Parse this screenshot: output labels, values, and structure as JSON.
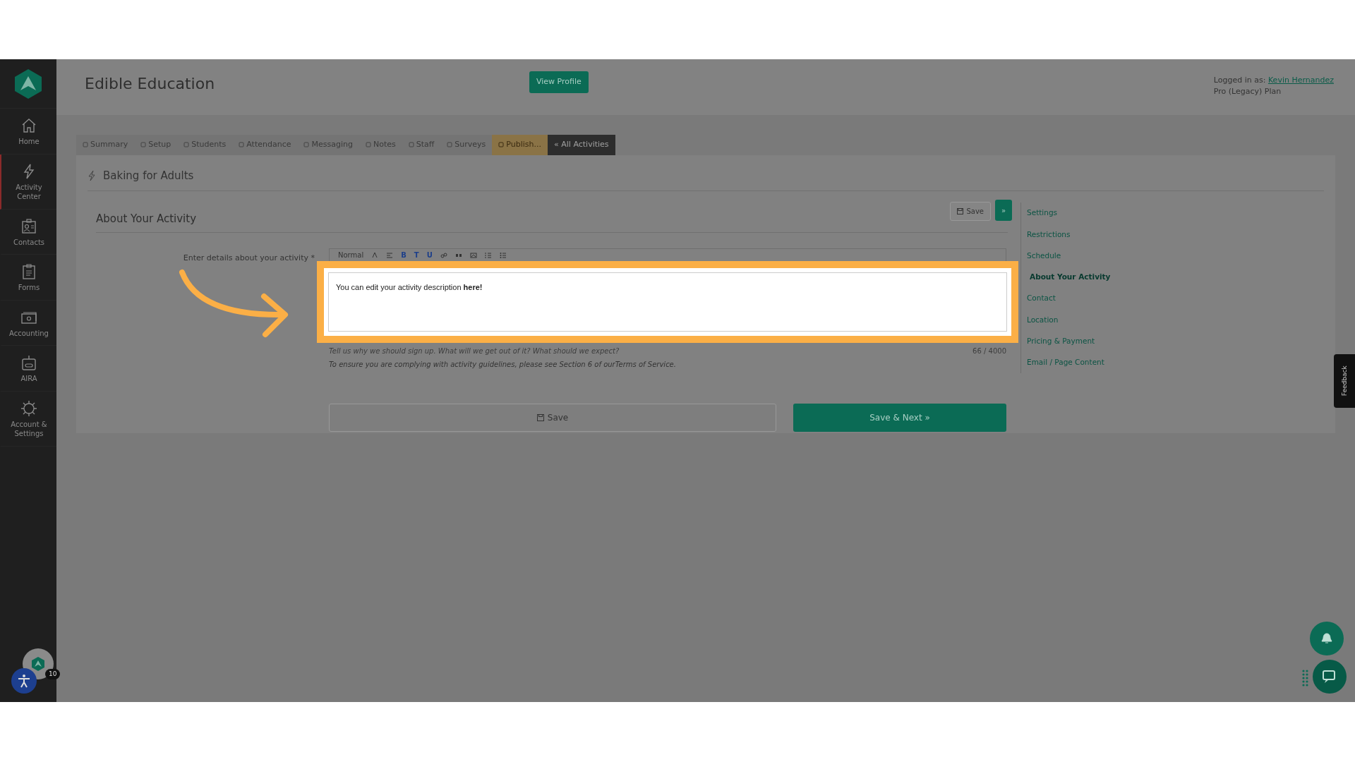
{
  "sidebar": {
    "items": [
      {
        "label": "Home",
        "selected": false
      },
      {
        "label": "Activity Center",
        "selected": true
      },
      {
        "label": "Contacts",
        "selected": false
      },
      {
        "label": "Forms",
        "selected": false
      },
      {
        "label": "Accounting",
        "selected": false
      },
      {
        "label": "AIRA",
        "selected": false
      },
      {
        "label": "Account & Settings",
        "selected": false
      }
    ],
    "badge": "10"
  },
  "header": {
    "title": "Edible Education",
    "view_profile": "View Profile",
    "logged_in_label": "Logged in as:",
    "user": "Kevin Hernandez",
    "plan": "Pro (Legacy) Plan"
  },
  "tabs": [
    {
      "label": "Summary",
      "kind": "tab"
    },
    {
      "label": "Setup",
      "kind": "tab"
    },
    {
      "label": "Students",
      "kind": "tab"
    },
    {
      "label": "Attendance",
      "kind": "tab"
    },
    {
      "label": "Messaging",
      "kind": "tab"
    },
    {
      "label": "Notes",
      "kind": "tab"
    },
    {
      "label": "Staff",
      "kind": "tab"
    },
    {
      "label": "Surveys",
      "kind": "tab"
    },
    {
      "label": "Publish...",
      "kind": "publish"
    },
    {
      "label": "« All Activities",
      "kind": "back"
    }
  ],
  "activity": {
    "title": "Baking for Adults"
  },
  "section": {
    "title": "About Your Activity",
    "save": "Save",
    "next": "»"
  },
  "field": {
    "label": "Enter details about your activity",
    "required_mark": "*",
    "toolbar": {
      "format": "Normal",
      "buttons": [
        {
          "kind": "color"
        },
        {
          "kind": "align"
        },
        {
          "kind": "text",
          "label": "B"
        },
        {
          "kind": "text",
          "label": "T"
        },
        {
          "kind": "text",
          "label": "U"
        },
        {
          "kind": "link"
        },
        {
          "kind": "quote"
        },
        {
          "kind": "image"
        },
        {
          "kind": "ordered"
        },
        {
          "kind": "bullets"
        }
      ]
    },
    "value": "You can edit your activity description **here!**",
    "hint": "Tell us why we should sign up. What will we get out of it? What should we expect?",
    "count": "66 / 4000",
    "terms_text": "To ensure you are complying with activity guidelines, please see Section 6 of our",
    "terms_link": "Terms of Service",
    "terms_end": "."
  },
  "buttons": {
    "save": "Save",
    "save_next": "Save & Next »"
  },
  "nav": [
    {
      "label": "Settings",
      "selected": false
    },
    {
      "label": "Restrictions",
      "selected": false
    },
    {
      "label": "Schedule",
      "selected": false
    },
    {
      "label": "About Your Activity",
      "selected": true
    },
    {
      "label": "Contact",
      "selected": false
    },
    {
      "label": "Location",
      "selected": false
    },
    {
      "label": "Pricing & Payment",
      "selected": false
    },
    {
      "label": "Email / Page Content",
      "selected": false
    }
  ],
  "feedback": "Feedback"
}
